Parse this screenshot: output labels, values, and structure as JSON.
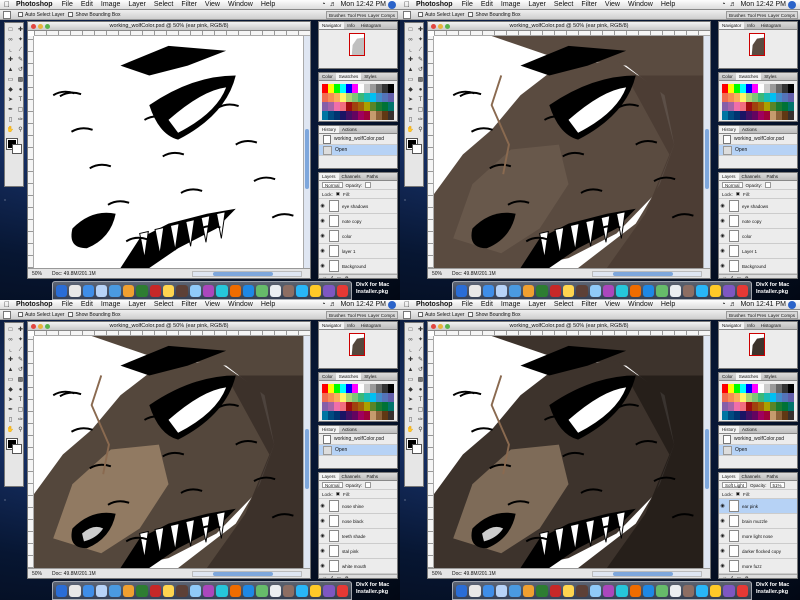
{
  "menubar": {
    "app": "Photoshop",
    "items": [
      "File",
      "Edit",
      "Image",
      "Layer",
      "Select",
      "Filter",
      "View",
      "Window",
      "Help"
    ]
  },
  "options_bar": {
    "auto_select": "Auto Select Layer",
    "bounding_box": "Show Bounding Box"
  },
  "palette_well": {
    "tabs": [
      "Brushes",
      "Tool Pres",
      "Layer Comps"
    ]
  },
  "document": {
    "title": "working_wolfColor.psd @ 50% (ear pink, RGB/8)",
    "doc_size": "Doc: 49.8M/201.1M"
  },
  "panels": {
    "navigator_tabs": [
      "Navigator",
      "Info",
      "Histogram"
    ],
    "color_tabs": [
      "Color",
      "Swatches",
      "Styles"
    ],
    "history_tabs": [
      "History",
      "Actions"
    ],
    "layers_tabs": [
      "Layers",
      "Channels",
      "Paths"
    ],
    "opacity_label": "Opacity:",
    "fill_label": "Fill:",
    "lock_label": "Lock:",
    "history_open": "Open"
  },
  "dock_label": "DivX for Mac Installer.pkg",
  "quadrants": [
    {
      "clock": "Mon 12:42 PM",
      "zoom": "50%",
      "history_file": "working_wolfColor.psd",
      "blend_mode": "Normal",
      "opacity": "",
      "layers": [
        "eye shadows",
        "note copy",
        "color",
        "layer 1",
        "Background"
      ],
      "stage": "lineart",
      "colors": {
        "fur": "#ffffff",
        "shade": "#ffffff",
        "skin": "#ffffff"
      }
    },
    {
      "clock": "Mon 12:42 PM",
      "zoom": "50%",
      "history_file": "working_wolfColor.psd",
      "blend_mode": "Normal",
      "opacity": "",
      "layers": [
        "eye shadows",
        "note copy",
        "color",
        "Layer 1",
        "Background"
      ],
      "stage": "flat",
      "colors": {
        "fur": "#5a4b40",
        "shade": "#4a3c33",
        "skin": "#6b5a4d"
      }
    },
    {
      "clock": "Mon 12:42 PM",
      "zoom": "50%",
      "history_file": "working_wolfColor.psd",
      "blend_mode": "Normal",
      "opacity": "",
      "layers": [
        "nose shine",
        "nose black",
        "teeth shade",
        "stal pink",
        "white mouth"
      ],
      "stage": "shaded",
      "colors": {
        "fur": "#54473c",
        "shade": "#3a2f28",
        "skin": "#9c8468"
      }
    },
    {
      "clock": "Mon 12:41 PM",
      "zoom": "50%",
      "history_file": "working_wolfColor.psd",
      "blend_mode": "Soft Light",
      "opacity": "51%",
      "layers": [
        "ear pink",
        "brain muzzle",
        "more light nose",
        "darker flocked copy",
        "more fuzz"
      ],
      "stage": "final",
      "colors": {
        "fur": "#3d332c",
        "shade": "#241d18",
        "skin": "#8a7560"
      }
    }
  ]
}
